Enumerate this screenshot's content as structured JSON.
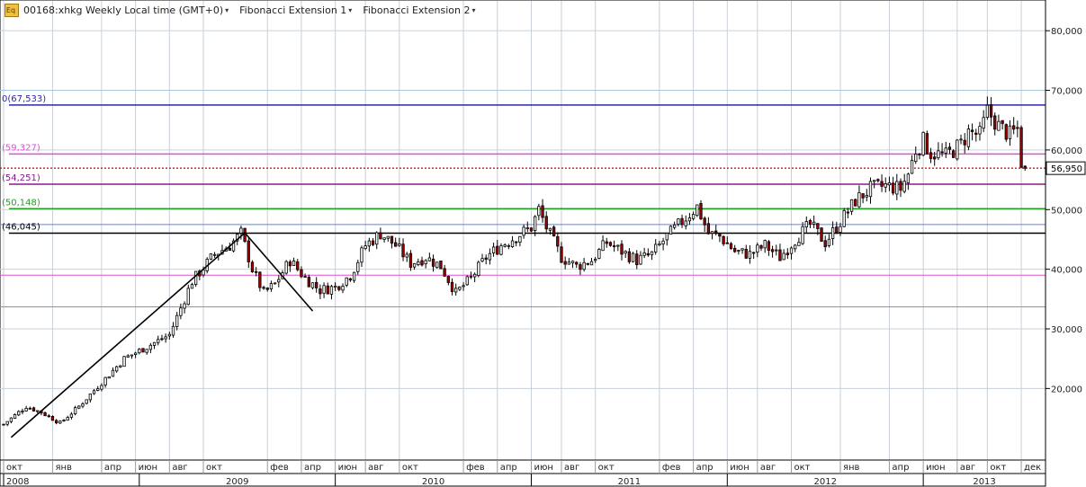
{
  "header": {
    "symbol_label": "00168:xhkg Weekly Local time (GMT+0)",
    "fib1_label": "Fibonacci Extension 1",
    "fib2_label": "Fibonacci Extension 2",
    "dropdown_glyph": "▾",
    "logo_glyph": "Eq"
  },
  "colors": {
    "candle_up": "#ffffff",
    "candle_down": "#a00000",
    "outline": "#000000",
    "grid": "#c8d0d8",
    "last_price_line": "#c00000"
  },
  "chart_data": {
    "type": "candlestick",
    "title": "00168:xhkg Weekly",
    "interval": "weekly",
    "y_ticks": [
      "80,000",
      "70,000",
      "60,000",
      "50,000",
      "40,000",
      "30,000",
      "20,000"
    ],
    "ylim": [
      8000,
      85000
    ],
    "last_price": "56,950",
    "last_price_value": 56950,
    "x_month_labels": [
      {
        "label": "окт",
        "t": 0
      },
      {
        "label": "янв",
        "t": 13
      },
      {
        "label": "апр",
        "t": 26
      },
      {
        "label": "июн",
        "t": 35
      },
      {
        "label": "авг",
        "t": 44
      },
      {
        "label": "окт",
        "t": 53
      },
      {
        "label": "фев",
        "t": 70
      },
      {
        "label": "апр",
        "t": 79
      },
      {
        "label": "июн",
        "t": 88
      },
      {
        "label": "авг",
        "t": 96
      },
      {
        "label": "окт",
        "t": 105
      },
      {
        "label": "фев",
        "t": 122
      },
      {
        "label": "апр",
        "t": 131
      },
      {
        "label": "июн",
        "t": 140
      },
      {
        "label": "авг",
        "t": 148
      },
      {
        "label": "окт",
        "t": 157
      },
      {
        "label": "фев",
        "t": 174
      },
      {
        "label": "апр",
        "t": 183
      },
      {
        "label": "июн",
        "t": 192
      },
      {
        "label": "авг",
        "t": 200
      },
      {
        "label": "окт",
        "t": 209
      },
      {
        "label": "янв",
        "t": 222
      },
      {
        "label": "апр",
        "t": 235
      },
      {
        "label": "июн",
        "t": 244
      },
      {
        "label": "авг",
        "t": 253
      },
      {
        "label": "окт",
        "t": 261
      },
      {
        "label": "дек",
        "t": 270
      }
    ],
    "x_year_labels": [
      {
        "label": "2008",
        "t": 0
      },
      {
        "label": "2009",
        "t": 36
      },
      {
        "label": "2010",
        "t": 88
      },
      {
        "label": "2011",
        "t": 140
      },
      {
        "label": "2012",
        "t": 192
      },
      {
        "label": "2013",
        "t": 244
      }
    ],
    "fib_levels": [
      {
        "label": "0(67,533)",
        "value": 67533,
        "color": "#2a2aa0"
      },
      {
        "label": "(59,327)",
        "value": 59327,
        "color": "#e050d0"
      },
      {
        "label": "(54,251)",
        "value": 54251,
        "color": "#8a1a8a"
      },
      {
        "label": "(50,148)",
        "value": 50148,
        "color": "#20a020"
      },
      {
        "label": "(46,045)",
        "value": 46045,
        "color": "#000000"
      }
    ],
    "extra_lines": [
      {
        "value": 70000,
        "color": "#a8c8d8"
      },
      {
        "value": 47500,
        "color": "#6080e0"
      },
      {
        "value": 39000,
        "color": "#e050d0"
      },
      {
        "value": 33700,
        "color": "#b080b0"
      }
    ],
    "trend_lines": [
      {
        "points": [
          {
            "t": 2,
            "v": 11800
          },
          {
            "t": 64,
            "v": 46100
          },
          {
            "t": 82,
            "v": 33000
          }
        ]
      }
    ],
    "weekly_close_anchors": [
      [
        0,
        14000
      ],
      [
        6,
        17000
      ],
      [
        10,
        16000
      ],
      [
        15,
        14200
      ],
      [
        20,
        17000
      ],
      [
        26,
        21000
      ],
      [
        32,
        25000
      ],
      [
        38,
        27000
      ],
      [
        44,
        29000
      ],
      [
        50,
        38000
      ],
      [
        56,
        42500
      ],
      [
        60,
        44000
      ],
      [
        63,
        46000
      ],
      [
        66,
        40000
      ],
      [
        69,
        36000
      ],
      [
        72,
        37500
      ],
      [
        76,
        41500
      ],
      [
        80,
        38500
      ],
      [
        84,
        36500
      ],
      [
        88,
        37000
      ],
      [
        92,
        39000
      ],
      [
        96,
        44000
      ],
      [
        100,
        46000
      ],
      [
        104,
        44000
      ],
      [
        108,
        41000
      ],
      [
        112,
        42000
      ],
      [
        116,
        40500
      ],
      [
        120,
        36000
      ],
      [
        124,
        38500
      ],
      [
        128,
        42000
      ],
      [
        132,
        44000
      ],
      [
        136,
        45500
      ],
      [
        140,
        47000
      ],
      [
        142,
        50000
      ],
      [
        144,
        47000
      ],
      [
        148,
        42000
      ],
      [
        152,
        40500
      ],
      [
        156,
        41500
      ],
      [
        160,
        44500
      ],
      [
        164,
        43000
      ],
      [
        168,
        41500
      ],
      [
        172,
        42500
      ],
      [
        176,
        45500
      ],
      [
        180,
        48000
      ],
      [
        184,
        50500
      ],
      [
        187,
        46000
      ],
      [
        190,
        45500
      ],
      [
        194,
        43000
      ],
      [
        198,
        42500
      ],
      [
        202,
        44000
      ],
      [
        206,
        42000
      ],
      [
        210,
        45000
      ],
      [
        214,
        47500
      ],
      [
        218,
        44500
      ],
      [
        222,
        48000
      ],
      [
        226,
        51500
      ],
      [
        230,
        53500
      ],
      [
        234,
        54000
      ],
      [
        238,
        53500
      ],
      [
        240,
        56000
      ],
      [
        242,
        60000
      ],
      [
        244,
        61500
      ],
      [
        246,
        59500
      ],
      [
        250,
        59000
      ],
      [
        254,
        61000
      ],
      [
        256,
        63000
      ],
      [
        259,
        62500
      ],
      [
        261,
        66500
      ],
      [
        264,
        64000
      ],
      [
        267,
        62500
      ],
      [
        269,
        63500
      ],
      [
        270,
        58000
      ],
      [
        271,
        56950
      ]
    ]
  }
}
